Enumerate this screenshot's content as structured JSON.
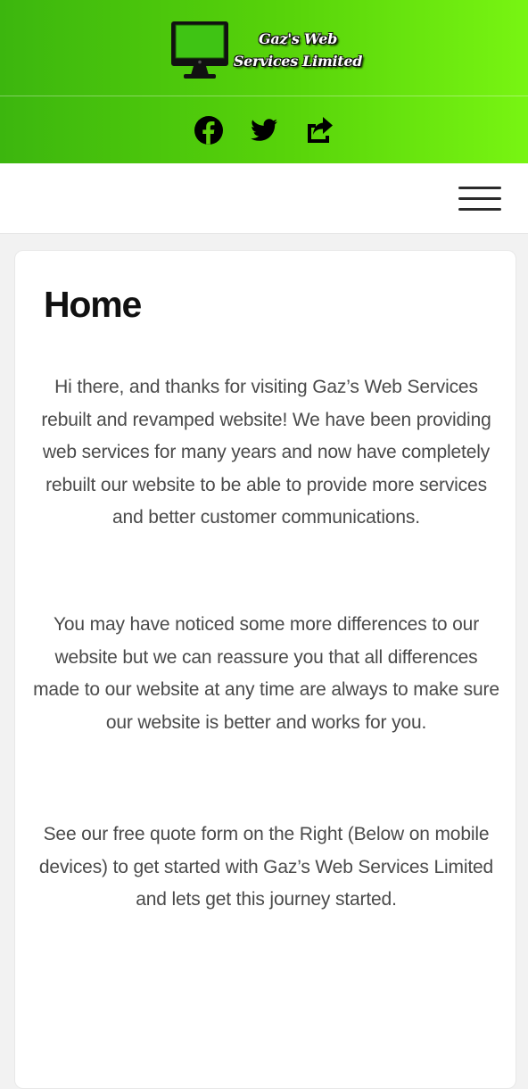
{
  "header": {
    "logo": {
      "line1": "Gaz's Web",
      "line2": "Services Limited",
      "icon": "computer-monitor-icon"
    },
    "social": [
      {
        "name": "facebook",
        "icon": "facebook-icon"
      },
      {
        "name": "twitter",
        "icon": "twitter-icon"
      },
      {
        "name": "share",
        "icon": "share-icon"
      }
    ],
    "colors": {
      "gradient_start": "#3cb60e",
      "gradient_end": "#78f512"
    }
  },
  "nav": {
    "menu_icon": "hamburger-menu-icon"
  },
  "main": {
    "title": "Home",
    "paragraphs": [
      "Hi there, and thanks for visiting Gaz’s Web Services rebuilt and revamped website! We have been providing web services for many years and now have completely rebuilt our website to be able to provide more services and better customer communications.",
      "You may have noticed some more differences to our website but we can reassure you that all differences made to our website at any time are always to make sure our website is better and works for you.",
      "See our free quote form on the Right (Below on mobile devices) to get started with Gaz’s Web Services Limited and lets get this journey started."
    ]
  }
}
